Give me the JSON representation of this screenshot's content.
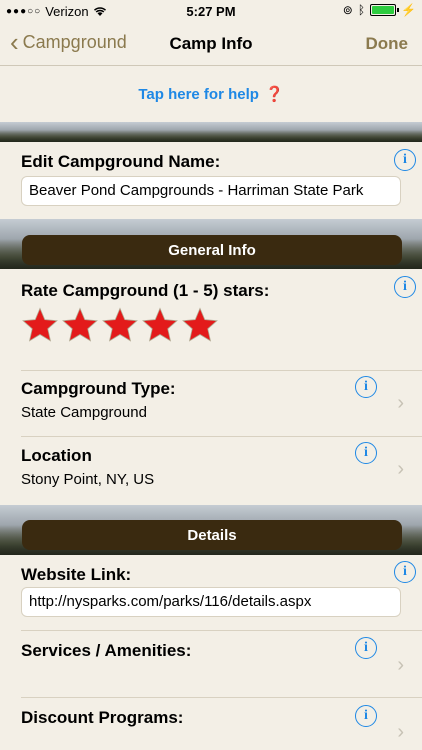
{
  "status": {
    "carrier": "Verizon",
    "time": "5:27 PM"
  },
  "nav": {
    "back_label": "Campground",
    "title": "Camp Info",
    "done_label": "Done"
  },
  "help": {
    "text": "Tap here for help",
    "icon": "❓"
  },
  "edit_name": {
    "label": "Edit Campground Name:",
    "value": "Beaver Pond Campgrounds - Harriman State Park"
  },
  "general_info": {
    "header": "General Info",
    "rating_label": "Rate Campground (1 - 5) stars:",
    "rating": 5,
    "type_label": "Campground Type:",
    "type_value": "State Campground",
    "location_label": "Location",
    "location_value": "Stony Point, NY, US"
  },
  "details": {
    "header": "Details",
    "website_label": "Website Link:",
    "website_value": "http://nysparks.com/parks/116/details.aspx",
    "services_label": "Services / Amenities:",
    "discount_label": "Discount Programs:"
  },
  "colors": {
    "accent": "#1e88e5",
    "nav_tint": "#8b7a4e",
    "section_bar": "#3a2a10",
    "star": "#e31b1b"
  }
}
